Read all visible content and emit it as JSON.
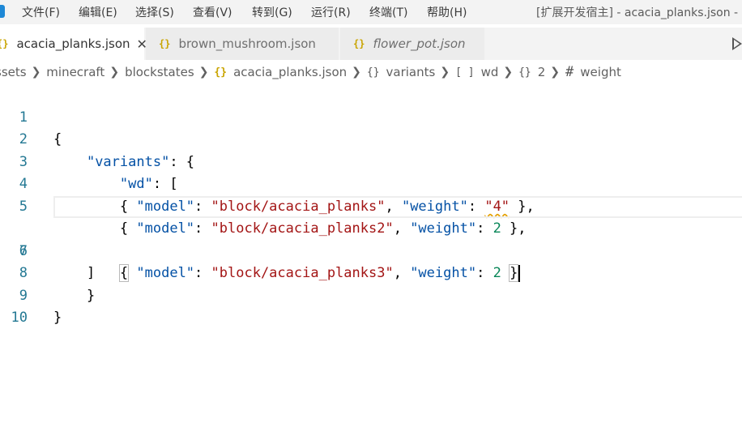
{
  "menubar": {
    "items": [
      "文件(F)",
      "编辑(E)",
      "选择(S)",
      "查看(V)",
      "转到(G)",
      "运行(R)",
      "终端(T)",
      "帮助(H)"
    ],
    "window_title": "[扩展开发宿主] - acacia_planks.json - 我"
  },
  "tabs": [
    {
      "label": "acacia_planks.json",
      "icon": "json-braces-icon",
      "active": true,
      "close": "✕"
    },
    {
      "label": "brown_mushroom.json",
      "icon": "json-braces-icon",
      "active": false
    },
    {
      "label": "flower_pot.json",
      "icon": "json-braces-icon",
      "active": false,
      "italic": true
    }
  ],
  "tab_icon_glyph": "{}",
  "breadcrumb": {
    "segments": [
      "ssets",
      "minecraft",
      "blockstates",
      "acacia_planks.json",
      "variants",
      "wd",
      "2",
      "weight"
    ],
    "icons": {
      "file": "{}",
      "object": "{}",
      "array": "[ ]",
      "number": "#"
    }
  },
  "editor": {
    "line_numbers": [
      "1",
      "2",
      "3",
      "4",
      "5",
      "6",
      "7",
      "8",
      "9",
      "10"
    ],
    "current_line": 6,
    "tokens": {
      "open_brace": "{",
      "close_brace": "}",
      "variants_key": "\"variants\"",
      "wd_key": "\"wd\"",
      "model_key": "\"model\"",
      "weight_key": "\"weight\"",
      "model_1": "\"block/acacia_planks\"",
      "model_2": "\"block/acacia_planks2\"",
      "model_3": "\"block/acacia_planks3\"",
      "weight_1": "\"4\"",
      "weight_2": "2",
      "weight_3": "2",
      "colon": ": ",
      "comma": ", ",
      "open_bracket": "[",
      "close_bracket": "]",
      "line_4_end": " },",
      "line_5_end": " },"
    }
  },
  "colors": {
    "key": "#0451a5",
    "string": "#a31515",
    "number": "#098658",
    "line_number": "#237893",
    "warning_squiggle": "#e5a000"
  }
}
